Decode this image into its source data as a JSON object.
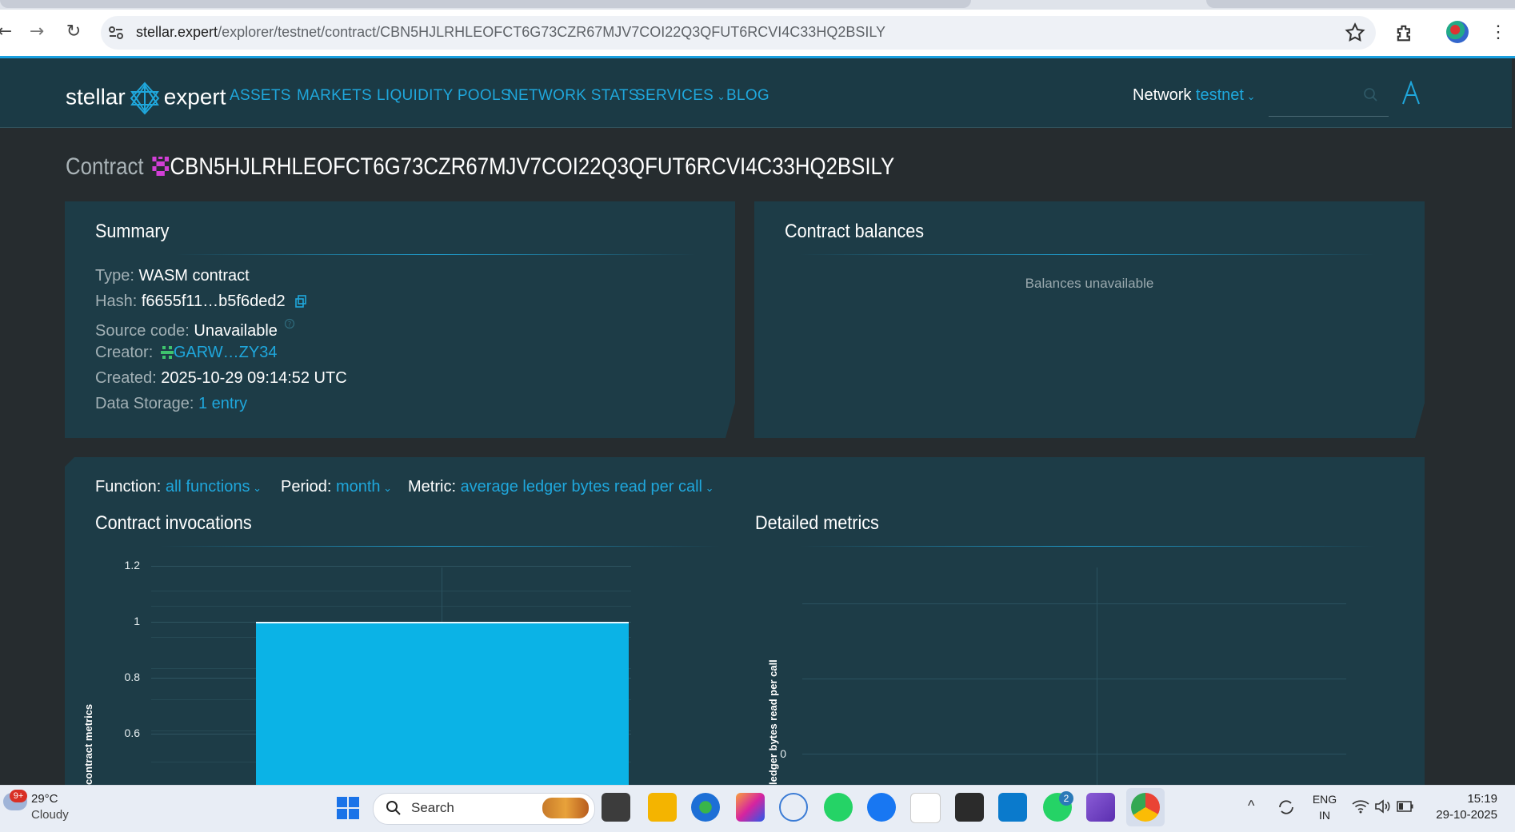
{
  "browser": {
    "url_host": "stellar.expert",
    "url_path": "/explorer/testnet/contract/CBN5HJLRHLEOFCT6G73CZR67MJV7COI22Q3QFUT6RCVI4C33HQ2BSILY",
    "icons": [
      "back-arrow-icon",
      "forward-arrow-icon",
      "reload-icon",
      "site-info-icon",
      "star-icon",
      "extensions-icon",
      "profile-avatar-icon",
      "menu-kebab-icon"
    ]
  },
  "site": {
    "logo_left": "stellar",
    "logo_right": "expert",
    "nav": [
      "ASSETS",
      "MARKETS",
      "LIQUIDITY POOLS",
      "NETWORK STATS",
      "SERVICES",
      "BLOG"
    ],
    "network_label": "Network",
    "network_value": "testnet",
    "accent": "#1fa7dc",
    "header_bg": "#1b3a45"
  },
  "page": {
    "title_label": "Contract",
    "contract_id": "CBN5HJLRHLEOFCT6G73CZR67MJV7COI22Q3QFUT6RCVI4C33HQ2BSILY"
  },
  "summary": {
    "title": "Summary",
    "type_k": "Type:",
    "type_v": "WASM contract",
    "hash_k": "Hash:",
    "hash_v": "f6655f11…b5f6ded2",
    "source_k": "Source code:",
    "source_v": "Unavailable",
    "creator_k": "Creator:",
    "creator_v": "GARW…ZY34",
    "created_k": "Created:",
    "created_v": "2025-10-29 09:14:52 UTC",
    "storage_k": "Data Storage:",
    "storage_v": "1 entry"
  },
  "balances": {
    "title": "Contract balances",
    "empty": "Balances unavailable"
  },
  "filters": {
    "function_k": "Function:",
    "function_v": "all functions",
    "period_k": "Period:",
    "period_v": "month",
    "metric_k": "Metric:",
    "metric_v": "average ledger bytes read per call"
  },
  "invocations": {
    "title": "Contract invocations",
    "ylabel": "contract metrics"
  },
  "detailed": {
    "title": "Detailed metrics",
    "ylabel": "ledger bytes read per call"
  },
  "chart_data": [
    {
      "type": "bar",
      "title": "Contract invocations",
      "ylabel": "contract metrics",
      "yticks": [
        "1.2",
        "1",
        "0.8",
        "0.6"
      ],
      "ytick_values": [
        1.2,
        1.0,
        0.8,
        0.6
      ],
      "ylim_visible": [
        0.6,
        1.2
      ],
      "values": [
        1
      ],
      "bar_color": "#0bb3e6",
      "grid": true
    },
    {
      "type": "line",
      "title": "Detailed metrics",
      "ylabel": "ledger bytes read per call",
      "yticks": [
        "0"
      ],
      "ytick_values": [
        0
      ],
      "grid": true
    }
  ],
  "taskbar": {
    "weather_temp": "29°C",
    "weather_desc": "Cloudy",
    "weather_badge": "9+",
    "search_placeholder": "Search",
    "whatsapp_badge": "2",
    "lang_top": "ENG",
    "lang_bottom": "IN",
    "time": "15:19",
    "date": "29-10-2025"
  }
}
